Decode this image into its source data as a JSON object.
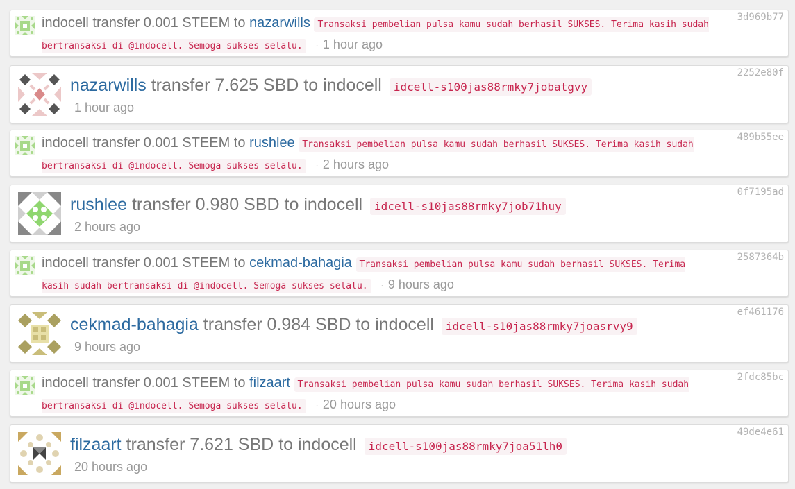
{
  "transfers": [
    {
      "txid": "3d969b77",
      "from": "indocell",
      "amount_text": "transfer 0.001 STEEM to",
      "to": "nazarwills",
      "memo": "Transaksi pembelian pulsa kamu sudah berhasil SUKSES. Terima kasih sudah bertransaksi di @indocell. Semoga sukses selalu.",
      "time": "1 hour ago"
    },
    {
      "txid": "2252e80f",
      "from": "nazarwills",
      "amount_text": "transfer 7.625 SBD to",
      "to": "indocell",
      "memo": "idcell-s100jas88rmky7jobatgvy",
      "time": "1 hour ago"
    },
    {
      "txid": "489b55ee",
      "from": "indocell",
      "amount_text": "transfer 0.001 STEEM to",
      "to": "rushlee",
      "memo": "Transaksi pembelian pulsa kamu sudah berhasil SUKSES. Terima kasih sudah bertransaksi di @indocell. Semoga sukses selalu.",
      "time": "2 hours ago"
    },
    {
      "txid": "0f7195ad",
      "from": "rushlee",
      "amount_text": "transfer 0.980 SBD to",
      "to": "indocell",
      "memo": "idcell-s10jas88rmky7job71huy",
      "time": "2 hours ago"
    },
    {
      "txid": "2587364b",
      "from": "indocell",
      "amount_text": "transfer 0.001 STEEM to",
      "to": "cekmad-bahagia",
      "memo": "Transaksi pembelian pulsa kamu sudah berhasil SUKSES. Terima kasih sudah bertransaksi di @indocell. Semoga sukses selalu.",
      "time": "9 hours ago"
    },
    {
      "txid": "ef461176",
      "from": "cekmad-bahagia",
      "amount_text": "transfer 0.984 SBD to",
      "to": "indocell",
      "memo": "idcell-s10jas88rmky7joasrvy9",
      "time": "9 hours ago"
    },
    {
      "txid": "2fdc85bc",
      "from": "indocell",
      "amount_text": "transfer 0.001 STEEM to",
      "to": "filzaart",
      "memo": "Transaksi pembelian pulsa kamu sudah berhasil SUKSES. Terima kasih sudah bertransaksi di @indocell. Semoga sukses selalu.",
      "time": "20 hours ago"
    },
    {
      "txid": "49de4e61",
      "from": "filzaart",
      "amount_text": "transfer 7.621 SBD to",
      "to": "indocell",
      "memo": "idcell-s100jas88rmky7joa51lh0",
      "time": "20 hours ago"
    }
  ],
  "colors": {
    "user_link": "#2c6aa0",
    "memo_text": "#c7254e",
    "memo_bg": "#f9f2f4",
    "identicon_indocell": "#a8d98a",
    "identicon_nazarwills": "#d98a8a",
    "identicon_rushlee": "#8fd66f",
    "identicon_cekmad": "#c9bd7a",
    "identicon_filzaart": "#d9c9a0"
  },
  "icons": [
    "identicon-indocell",
    "identicon-nazarwills",
    "identicon-rushlee",
    "identicon-cekmad-bahagia",
    "identicon-filzaart"
  ]
}
